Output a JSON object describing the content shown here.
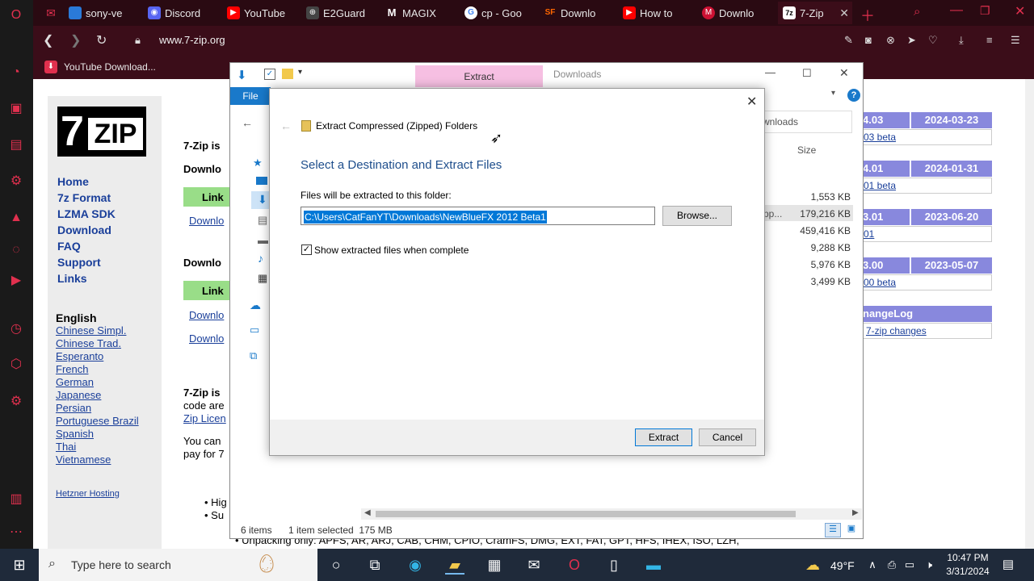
{
  "browser": {
    "tabs": [
      {
        "label": "sony-ve",
        "color": "#2a7ad8"
      },
      {
        "label": "Discord",
        "color": "#5865f2"
      },
      {
        "label": "YouTube",
        "color": "#ff0000"
      },
      {
        "label": "E2Guard",
        "color": "#444444"
      },
      {
        "label": "MAGIX",
        "color": "#222222"
      },
      {
        "label": "cp - Goo",
        "color": "#ffffff"
      },
      {
        "label": "Downlo",
        "color": "#ff6600"
      },
      {
        "label": "How to",
        "color": "#ff0000"
      },
      {
        "label": "Downlo",
        "color": "#cc1133"
      },
      {
        "label": "7-Zip",
        "color": "#333333"
      }
    ],
    "url": "www.7-zip.org",
    "bookmark": "YouTube Download..."
  },
  "site": {
    "nav": [
      "Home",
      "7z Format",
      "LZMA SDK",
      "Download",
      "FAQ",
      "Support",
      "Links"
    ],
    "lang_title": "English",
    "languages": [
      "Chinese Simpl.",
      "Chinese Trad.",
      "Esperanto",
      "French",
      "German",
      "Japanese",
      "Persian",
      "Portuguese Brazil",
      "Spanish",
      "Thai",
      "Vietnamese"
    ],
    "hosting": "Hetzner Hosting",
    "body": {
      "p1": "7-Zip is",
      "download1": "Downlo",
      "link_head": "Link",
      "dl_a": "Downlo",
      "download2": "Downlo",
      "link_head2": "Link",
      "dl_b": "Downlo",
      "dl_c": "Downlo",
      "p2a": "7-Zip is",
      "p2b": "code are",
      "p2c": "Zip Licen",
      "p3a": "You can",
      "p3b": "pay for 7",
      "bullet1": "Hig",
      "bullet2": "Su",
      "unpacking": "Unpacking only: APFS, AR, ARJ, CAB, CHM, CPIO, CramFS, DMG, EXT, FAT, GPT, HFS, IHEX, ISO, LZH,"
    },
    "versions": [
      {
        "ver": "4.03",
        "date": "2024-03-23",
        "link": "03 beta"
      },
      {
        "ver": "4.01",
        "date": "2024-01-31",
        "link": "01 beta"
      },
      {
        "ver": "3.01",
        "date": "2023-06-20",
        "link": "01"
      },
      {
        "ver": "3.00",
        "date": "2023-05-07",
        "link": "00 beta"
      }
    ],
    "changelog_head": "nangeLog",
    "changelog_link": "7-zip changes"
  },
  "explorer": {
    "ribbon_tab": "Extract",
    "ribbon_title": "Downloads",
    "file_tab": "File",
    "search_placeholder": "wnloads",
    "size_header": "Size",
    "sizes": [
      "1,553 KB",
      "179,216 KB",
      "459,416 KB",
      "9,288 KB",
      "5,976 KB",
      "3,499 KB"
    ],
    "truncated_type": "pp...",
    "status_items": "6 items",
    "status_selected": "1 item selected  175 MB"
  },
  "dialog": {
    "title": "Extract Compressed (Zipped) Folders",
    "heading": "Select a Destination and Extract Files",
    "label": "Files will be extracted to this folder:",
    "path": "C:\\Users\\CatFanYT\\Downloads\\NewBlueFX 2012 Beta1",
    "browse": "Browse...",
    "checkbox_label": "Show extracted files when complete",
    "checkbox_checked": true,
    "extract": "Extract",
    "cancel": "Cancel"
  },
  "taskbar": {
    "search_placeholder": "Type here to search",
    "temp": "49°F",
    "time": "10:47 PM",
    "date": "3/31/2024"
  }
}
